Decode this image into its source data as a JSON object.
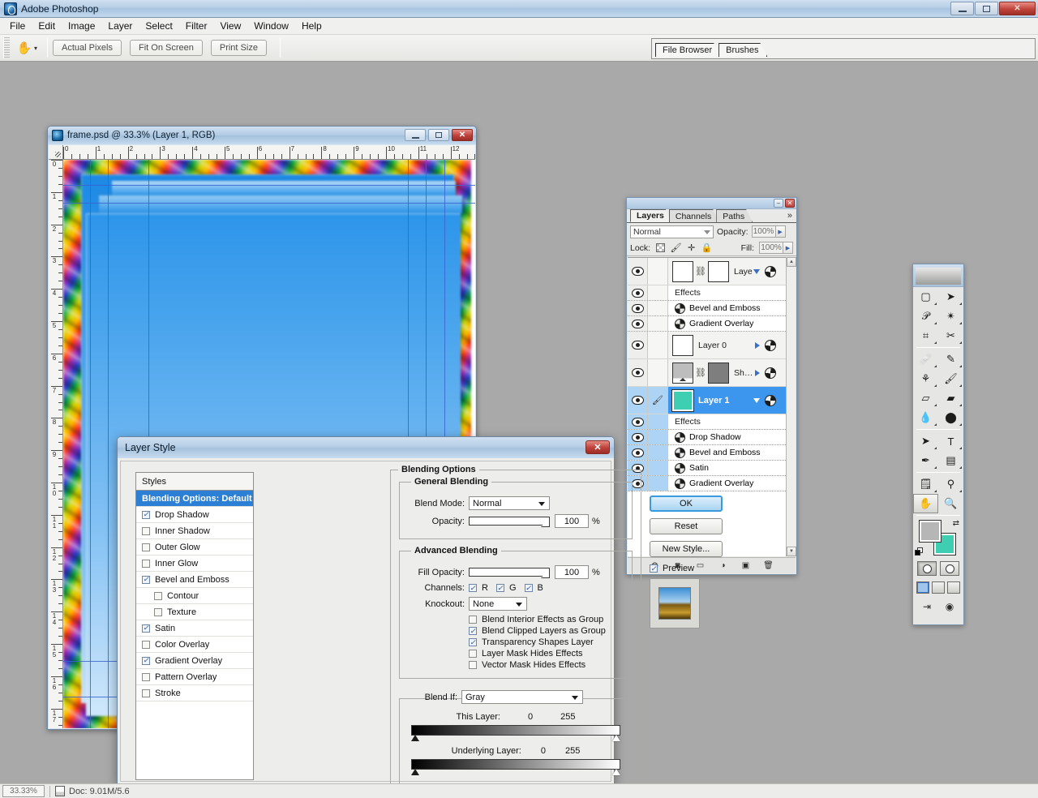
{
  "app": {
    "title": "Adobe Photoshop",
    "window_buttons": {
      "minimize": "–",
      "restore": "❐",
      "close": "✕"
    }
  },
  "menubar": {
    "items": [
      "File",
      "Edit",
      "Image",
      "Layer",
      "Select",
      "Filter",
      "View",
      "Window",
      "Help"
    ]
  },
  "options_bar": {
    "tool": "hand-tool",
    "buttons": [
      "Actual Pixels",
      "Fit On Screen",
      "Print Size"
    ]
  },
  "palette_well": {
    "tabs": [
      "File Browser",
      "Brushes"
    ]
  },
  "document": {
    "title": "frame.psd @ 33.3% (Layer 1, RGB)",
    "ruler_h_labels": [
      "0",
      "1",
      "2",
      "3",
      "4",
      "5",
      "6",
      "7",
      "8",
      "9",
      "10",
      "11",
      "12"
    ],
    "ruler_v_labels": [
      "0",
      "1",
      "2",
      "3",
      "4",
      "5",
      "6",
      "7",
      "8",
      "9",
      "10",
      "11",
      "12",
      "13",
      "14",
      "15",
      "16",
      "17"
    ],
    "buttons": {
      "minimize": "–",
      "restore": "❐",
      "close": "✕"
    }
  },
  "status_bar": {
    "zoom": "33.33%",
    "doc_info": "Doc: 9.01M/5.6"
  },
  "layers_palette": {
    "tabs": [
      "Layers",
      "Channels",
      "Paths"
    ],
    "active_tab": "Layers",
    "more_icon": "»",
    "blend_mode": "Normal",
    "opacity_label": "Opacity:",
    "opacity_value": "100%",
    "lock_label": "Lock:",
    "fill_label": "Fill:",
    "fill_value": "100%",
    "lock_icons": [
      "transparency-lock-icon",
      "paint-lock-icon",
      "move-lock-icon",
      "all-lock-icon"
    ],
    "rows": [
      {
        "kind": "layer",
        "name": "Laye…",
        "thumb": "white",
        "has_mask": true,
        "expander": "down",
        "fx": true,
        "selected": false
      },
      {
        "kind": "effects-header",
        "name": "Effects"
      },
      {
        "kind": "effect",
        "name": "Bevel and Emboss"
      },
      {
        "kind": "effect",
        "name": "Gradient Overlay"
      },
      {
        "kind": "layer",
        "name": "Layer 0",
        "thumb": "white",
        "has_mask": false,
        "expander": "right",
        "fx": true,
        "selected": false
      },
      {
        "kind": "layer",
        "name": "Sh…",
        "thumb": "gray",
        "has_mask": true,
        "expander": "right",
        "fx": true,
        "selected": false
      },
      {
        "kind": "layer",
        "name": "Layer 1",
        "thumb": "teal",
        "has_mask": false,
        "expander": "down",
        "fx": true,
        "selected": true
      },
      {
        "kind": "effects-header",
        "name": "Effects"
      },
      {
        "kind": "effect",
        "name": "Drop Shadow"
      },
      {
        "kind": "effect",
        "name": "Bevel and Emboss"
      },
      {
        "kind": "effect",
        "name": "Satin"
      },
      {
        "kind": "effect",
        "name": "Gradient Overlay"
      }
    ],
    "bottom_icons": [
      "layer-style-icon",
      "layer-mask-icon",
      "new-group-icon",
      "adjustment-layer-icon",
      "new-layer-icon",
      "delete-layer-icon"
    ]
  },
  "tools_palette": {
    "tools": [
      "marquee-tool",
      "move-tool",
      "lasso-tool",
      "magic-wand-tool",
      "crop-tool",
      "slice-tool",
      "healing-brush-tool",
      "brush-tool",
      "clone-stamp-tool",
      "history-brush-tool",
      "eraser-tool",
      "gradient-tool",
      "blur-tool",
      "dodge-tool",
      "path-selection-tool",
      "type-tool",
      "pen-tool",
      "shape-tool",
      "notes-tool",
      "eyedropper-tool",
      "hand-tool",
      "zoom-tool"
    ],
    "selected_tool": "hand-tool",
    "foreground_color": "#b6b6b6",
    "background_color": "#3ecfb2",
    "mode_buttons": [
      "standard-mask-mode",
      "quick-mask-mode"
    ],
    "screen_buttons": [
      "standard-screen-mode",
      "full-screen-menubar-mode",
      "full-screen-mode"
    ],
    "jump_buttons": [
      "jump-to-imageready-icon",
      "jump-to-other-icon"
    ]
  },
  "layer_style_dialog": {
    "title": "Layer Style",
    "close_label": "✕",
    "styles_header": "Styles",
    "styles": [
      {
        "label": "Blending Options: Default",
        "checkbox": null,
        "selected": true,
        "indent": false
      },
      {
        "label": "Drop Shadow",
        "checkbox": true,
        "selected": false,
        "indent": false
      },
      {
        "label": "Inner Shadow",
        "checkbox": false,
        "selected": false,
        "indent": false
      },
      {
        "label": "Outer Glow",
        "checkbox": false,
        "selected": false,
        "indent": false
      },
      {
        "label": "Inner Glow",
        "checkbox": false,
        "selected": false,
        "indent": false
      },
      {
        "label": "Bevel and Emboss",
        "checkbox": true,
        "selected": false,
        "indent": false
      },
      {
        "label": "Contour",
        "checkbox": false,
        "selected": false,
        "indent": true
      },
      {
        "label": "Texture",
        "checkbox": false,
        "selected": false,
        "indent": true
      },
      {
        "label": "Satin",
        "checkbox": true,
        "selected": false,
        "indent": false
      },
      {
        "label": "Color Overlay",
        "checkbox": false,
        "selected": false,
        "indent": false
      },
      {
        "label": "Gradient Overlay",
        "checkbox": true,
        "selected": false,
        "indent": false
      },
      {
        "label": "Pattern Overlay",
        "checkbox": false,
        "selected": false,
        "indent": false
      },
      {
        "label": "Stroke",
        "checkbox": false,
        "selected": false,
        "indent": false
      }
    ],
    "blending_options_title": "Blending Options",
    "general_blending": {
      "title": "General Blending",
      "blend_mode_label": "Blend Mode:",
      "blend_mode_value": "Normal",
      "opacity_label": "Opacity:",
      "opacity_value": "100",
      "opacity_unit": "%"
    },
    "advanced_blending": {
      "title": "Advanced Blending",
      "fill_opacity_label": "Fill Opacity:",
      "fill_opacity_value": "100",
      "fill_opacity_unit": "%",
      "channels_label": "Channels:",
      "channels": [
        {
          "label": "R",
          "checked": true
        },
        {
          "label": "G",
          "checked": true
        },
        {
          "label": "B",
          "checked": true
        }
      ],
      "knockout_label": "Knockout:",
      "knockout_value": "None",
      "checkboxes": [
        {
          "label": "Blend Interior Effects as Group",
          "checked": false
        },
        {
          "label": "Blend Clipped Layers as Group",
          "checked": true
        },
        {
          "label": "Transparency Shapes Layer",
          "checked": true
        },
        {
          "label": "Layer Mask Hides Effects",
          "checked": false
        },
        {
          "label": "Vector Mask Hides Effects",
          "checked": false
        }
      ]
    },
    "blend_if": {
      "label": "Blend If:",
      "value": "Gray",
      "this_layer_label": "This Layer:",
      "this_layer_min": "0",
      "this_layer_max": "255",
      "underlying_layer_label": "Underlying Layer:",
      "underlying_layer_min": "0",
      "underlying_layer_max": "255"
    },
    "buttons": {
      "ok": "OK",
      "reset": "Reset",
      "new_style": "New Style...",
      "preview_label": "Preview",
      "preview_checked": true
    }
  }
}
